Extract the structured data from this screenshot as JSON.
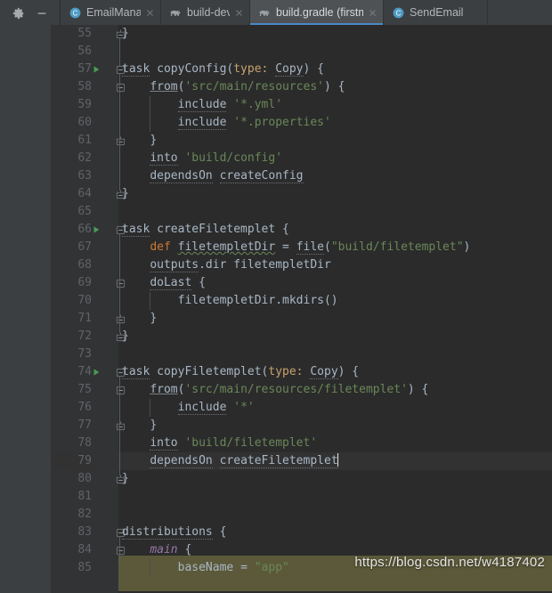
{
  "window": {
    "app": "IntelliJ IDEA",
    "theme_colors": {
      "tabbar_bg": "#3c3f41",
      "editor_bg": "#2b2b2b",
      "gutter_bg": "#313335",
      "active_tab_bg": "#4e5254",
      "active_tab_underline": "#4a88c7",
      "current_line_bg": "#323232",
      "lineno_fg": "#606366",
      "code_fg": "#a9b7c6",
      "string_fg": "#6a8759",
      "keyword_fg": "#cc7832",
      "named_arg_fg": "#c9a26d",
      "field_fg": "#9876aa",
      "highlight_band": "#5e5c3a",
      "run_icon_fg": "#499c54"
    }
  },
  "toolbar": {
    "buttons": [
      {
        "name": "settings-gear-button",
        "icon": "gear-icon",
        "tooltip": "Settings"
      },
      {
        "name": "hide-panel-button",
        "icon": "minus-icon",
        "tooltip": "Hide"
      }
    ]
  },
  "tabs": [
    {
      "label": "EmailManageSe",
      "icon": "java-class-icon",
      "active": false,
      "closable": true
    },
    {
      "label": "build-dev",
      "icon": "gradle-elephant-icon",
      "active": false,
      "closable": true
    },
    {
      "label": "build.gradle (firstmeet-boss-",
      "icon": "gradle-elephant-icon",
      "active": true,
      "closable": true
    },
    {
      "label": "SendEmail",
      "icon": "java-class-icon",
      "active": false,
      "closable": true
    }
  ],
  "editor": {
    "language": "gradle",
    "first_line": 55,
    "current_line": 79,
    "caret_line": 79,
    "caret_column_text": "dependsOn createFiletemplet",
    "lines": [
      {
        "n": 55,
        "indent": 0,
        "fold": "end",
        "run": false,
        "tokens": [
          {
            "t": "}",
            "c": "s-brace"
          }
        ]
      },
      {
        "n": 56,
        "indent": 0,
        "fold": null,
        "run": false,
        "tokens": []
      },
      {
        "n": 57,
        "indent": 0,
        "fold": "start",
        "run": true,
        "tokens": [
          {
            "t": "task",
            "c": "s-plain",
            "u": "dot"
          },
          {
            "t": " copyConfig(",
            "c": "s-plain"
          },
          {
            "t": "type:",
            "c": "s-named"
          },
          {
            "t": " ",
            "c": "s-plain"
          },
          {
            "t": "Copy",
            "c": "s-plain",
            "u": "dot"
          },
          {
            "t": ") {",
            "c": "s-plain"
          }
        ]
      },
      {
        "n": 58,
        "indent": 1,
        "fold": "start",
        "run": false,
        "tokens": [
          {
            "t": "from",
            "c": "s-plain",
            "u": "sol"
          },
          {
            "t": "(",
            "c": "s-plain"
          },
          {
            "t": "'src/main/resources'",
            "c": "s-str"
          },
          {
            "t": ") {",
            "c": "s-plain"
          }
        ]
      },
      {
        "n": 59,
        "indent": 2,
        "fold": null,
        "run": false,
        "tokens": [
          {
            "t": "include",
            "c": "s-plain",
            "u": "dot"
          },
          {
            "t": " ",
            "c": "s-plain"
          },
          {
            "t": "'*.yml'",
            "c": "s-str"
          }
        ]
      },
      {
        "n": 60,
        "indent": 2,
        "fold": null,
        "run": false,
        "tokens": [
          {
            "t": "include",
            "c": "s-plain",
            "u": "dot"
          },
          {
            "t": " ",
            "c": "s-plain"
          },
          {
            "t": "'*.properties'",
            "c": "s-str"
          }
        ]
      },
      {
        "n": 61,
        "indent": 1,
        "fold": "end",
        "run": false,
        "tokens": [
          {
            "t": "}",
            "c": "s-brace"
          }
        ]
      },
      {
        "n": 62,
        "indent": 1,
        "fold": null,
        "run": false,
        "tokens": [
          {
            "t": "into",
            "c": "s-plain",
            "u": "dot"
          },
          {
            "t": " ",
            "c": "s-plain"
          },
          {
            "t": "'build/config'",
            "c": "s-str"
          }
        ]
      },
      {
        "n": 63,
        "indent": 1,
        "fold": null,
        "run": false,
        "tokens": [
          {
            "t": "dependsOn",
            "c": "s-plain",
            "u": "dot"
          },
          {
            "t": " ",
            "c": "s-plain"
          },
          {
            "t": "createConfig",
            "c": "s-plain",
            "u": "dot"
          }
        ]
      },
      {
        "n": 64,
        "indent": 0,
        "fold": "end",
        "run": false,
        "tokens": [
          {
            "t": "}",
            "c": "s-brace"
          }
        ]
      },
      {
        "n": 65,
        "indent": 0,
        "fold": null,
        "run": false,
        "tokens": []
      },
      {
        "n": 66,
        "indent": 0,
        "fold": "start",
        "run": true,
        "tokens": [
          {
            "t": "task",
            "c": "s-plain",
            "u": "dot"
          },
          {
            "t": " createFiletemplet {",
            "c": "s-plain"
          }
        ]
      },
      {
        "n": 67,
        "indent": 1,
        "fold": null,
        "run": false,
        "tokens": [
          {
            "t": "def",
            "c": "s-kw"
          },
          {
            "t": " ",
            "c": "s-plain"
          },
          {
            "t": "filetempletDir",
            "c": "s-plain",
            "u": "wave"
          },
          {
            "t": " = ",
            "c": "s-plain"
          },
          {
            "t": "file",
            "c": "s-plain",
            "u": "dot"
          },
          {
            "t": "(",
            "c": "s-plain"
          },
          {
            "t": "\"build/filetemplet\"",
            "c": "s-str"
          },
          {
            "t": ")",
            "c": "s-plain"
          }
        ]
      },
      {
        "n": 68,
        "indent": 1,
        "fold": null,
        "run": false,
        "tokens": [
          {
            "t": "outputs",
            "c": "s-plain",
            "u": "dot"
          },
          {
            "t": ".dir filetempletDir",
            "c": "s-plain"
          }
        ]
      },
      {
        "n": 69,
        "indent": 1,
        "fold": "start",
        "run": false,
        "tokens": [
          {
            "t": "doLast",
            "c": "s-plain",
            "u": "dot"
          },
          {
            "t": " {",
            "c": "s-plain"
          }
        ]
      },
      {
        "n": 70,
        "indent": 2,
        "fold": null,
        "run": false,
        "tokens": [
          {
            "t": "filetempletDir.mkdirs()",
            "c": "s-plain"
          }
        ]
      },
      {
        "n": 71,
        "indent": 1,
        "fold": "end",
        "run": false,
        "tokens": [
          {
            "t": "}",
            "c": "s-brace"
          }
        ]
      },
      {
        "n": 72,
        "indent": 0,
        "fold": "end",
        "run": false,
        "tokens": [
          {
            "t": "}",
            "c": "s-brace"
          }
        ]
      },
      {
        "n": 73,
        "indent": 0,
        "fold": null,
        "run": false,
        "tokens": []
      },
      {
        "n": 74,
        "indent": 0,
        "fold": "start",
        "run": true,
        "tokens": [
          {
            "t": "task",
            "c": "s-plain",
            "u": "dot"
          },
          {
            "t": " copyFiletemplet(",
            "c": "s-plain"
          },
          {
            "t": "type:",
            "c": "s-named"
          },
          {
            "t": " ",
            "c": "s-plain"
          },
          {
            "t": "Copy",
            "c": "s-plain",
            "u": "dot"
          },
          {
            "t": ") {",
            "c": "s-plain"
          }
        ]
      },
      {
        "n": 75,
        "indent": 1,
        "fold": "start",
        "run": false,
        "tokens": [
          {
            "t": "from",
            "c": "s-plain",
            "u": "sol"
          },
          {
            "t": "(",
            "c": "s-plain"
          },
          {
            "t": "'src/main/resources/filetemplet'",
            "c": "s-str"
          },
          {
            "t": ") {",
            "c": "s-plain"
          }
        ]
      },
      {
        "n": 76,
        "indent": 2,
        "fold": null,
        "run": false,
        "tokens": [
          {
            "t": "include",
            "c": "s-plain",
            "u": "dot"
          },
          {
            "t": " ",
            "c": "s-plain"
          },
          {
            "t": "'*'",
            "c": "s-str"
          }
        ]
      },
      {
        "n": 77,
        "indent": 1,
        "fold": "end",
        "run": false,
        "tokens": [
          {
            "t": "}",
            "c": "s-brace"
          }
        ]
      },
      {
        "n": 78,
        "indent": 1,
        "fold": null,
        "run": false,
        "tokens": [
          {
            "t": "into",
            "c": "s-plain",
            "u": "dot"
          },
          {
            "t": " ",
            "c": "s-plain"
          },
          {
            "t": "'build/filetemplet'",
            "c": "s-str"
          }
        ]
      },
      {
        "n": 79,
        "indent": 1,
        "fold": null,
        "run": false,
        "current": true,
        "caret": true,
        "tokens": [
          {
            "t": "dependsOn",
            "c": "s-plain",
            "u": "dot"
          },
          {
            "t": " ",
            "c": "s-plain"
          },
          {
            "t": "createFiletemplet",
            "c": "s-plain",
            "u": "dot"
          }
        ]
      },
      {
        "n": 80,
        "indent": 0,
        "fold": "end",
        "run": false,
        "tokens": [
          {
            "t": "}",
            "c": "s-brace"
          }
        ]
      },
      {
        "n": 81,
        "indent": 0,
        "fold": null,
        "run": false,
        "tokens": []
      },
      {
        "n": 82,
        "indent": 0,
        "fold": null,
        "run": false,
        "tokens": []
      },
      {
        "n": 83,
        "indent": 0,
        "fold": "start",
        "run": false,
        "tokens": [
          {
            "t": "distributions",
            "c": "s-plain",
            "u": "dot"
          },
          {
            "t": " {",
            "c": "s-plain"
          }
        ]
      },
      {
        "n": 84,
        "indent": 1,
        "fold": "start",
        "run": false,
        "tokens": [
          {
            "t": "main",
            "c": "s-field"
          },
          {
            "t": " {",
            "c": "s-plain"
          }
        ]
      },
      {
        "n": 85,
        "indent": 2,
        "fold": null,
        "run": false,
        "clipped": true,
        "tokens": [
          {
            "t": "baseName = ",
            "c": "s-plain"
          },
          {
            "t": "\"app\"",
            "c": "s-str"
          }
        ]
      }
    ]
  },
  "watermark": {
    "text": "https://blog.csdn.net/w4187402"
  }
}
